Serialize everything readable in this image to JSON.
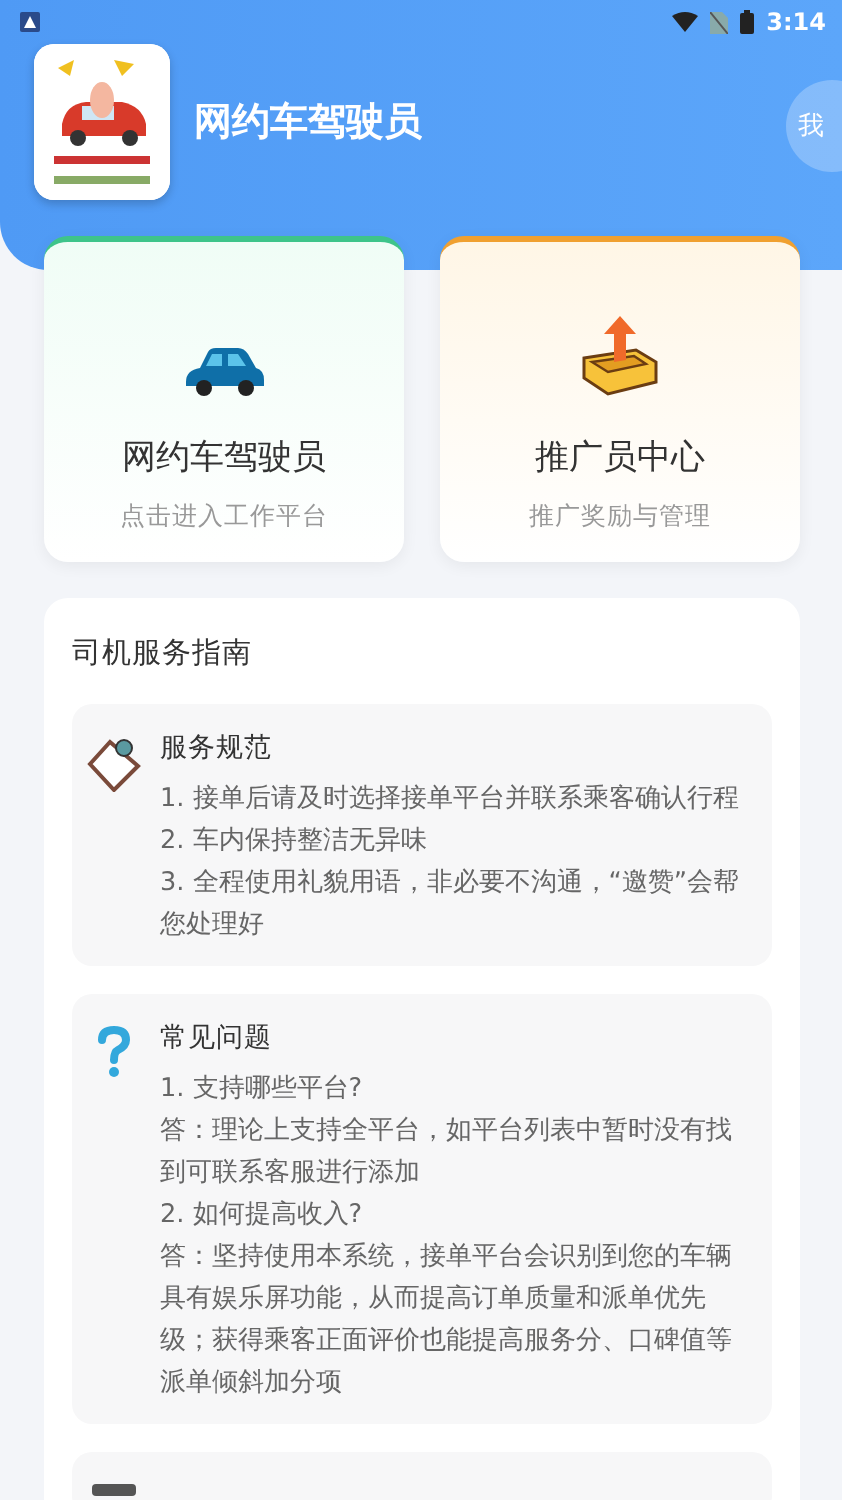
{
  "status_bar": {
    "time": "3:14"
  },
  "header": {
    "title": "网约车驾驶员",
    "profile_button": "我"
  },
  "entry_cards": [
    {
      "kind": "driver",
      "title": "网约车驾驶员",
      "subtitle": "点击进入工作平台",
      "color": "#3ec48a"
    },
    {
      "kind": "promoter",
      "title": "推广员中心",
      "subtitle": "推广奖励与管理",
      "color": "#f0a030"
    }
  ],
  "guide": {
    "title": "司机服务指南",
    "sections": [
      {
        "kind": "rules",
        "title": "服务规范",
        "lines": [
          "1. 接单后请及时选择接单平台并联系乘客确认行程",
          "2. 车内保持整洁无异味",
          "3. 全程使用礼貌用语，非必要不沟通，“邀赞”会帮您处理好"
        ]
      },
      {
        "kind": "faq",
        "title": "常见问题",
        "lines": [
          "1. 支持哪些平台?",
          "答：理论上支持全平台，如平台列表中暂时没有找到可联系客服进行添加",
          "2. 如何提高收入?",
          "答：坚持使用本系统，接单平台会识别到您的车辆具有娱乐屏功能，从而提高订单质量和派单优先级；获得乘客正面评价也能提高服务分、口碑值等派单倾斜加分项"
        ]
      },
      {
        "kind": "tips"
      }
    ]
  }
}
